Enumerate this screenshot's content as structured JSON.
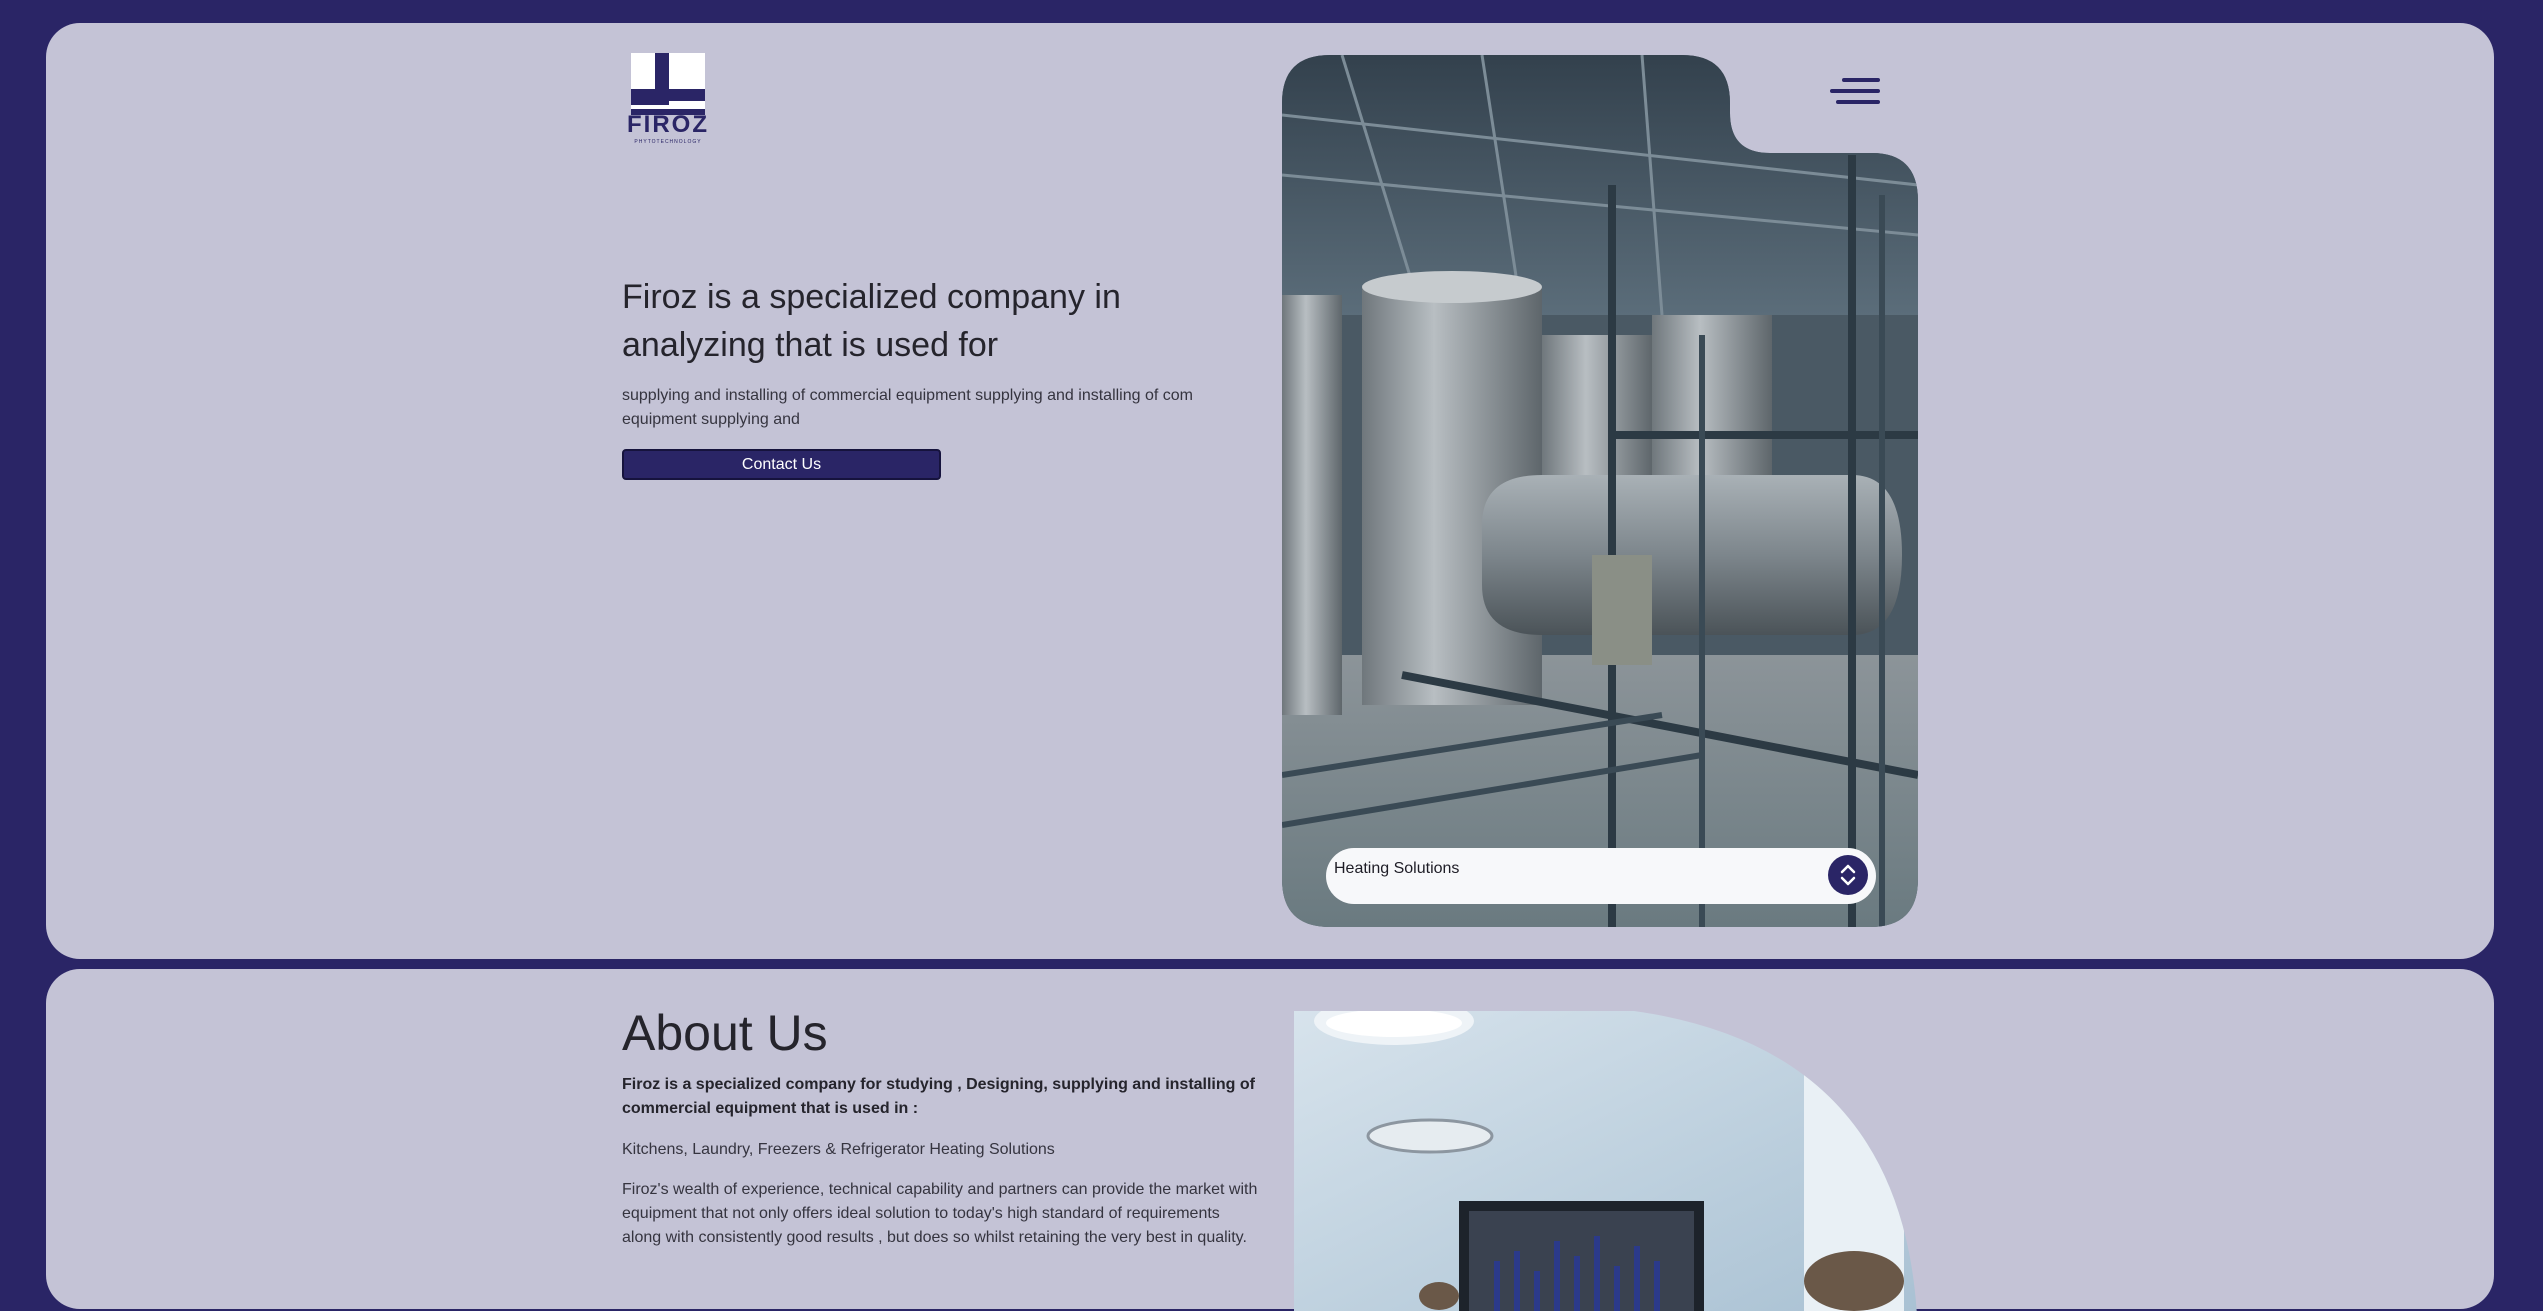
{
  "brand": {
    "name": "FIROZ",
    "tagline": "PHYTOTECHNOLOGY"
  },
  "hero": {
    "title": "Firoz is a specialized company in analyzing that is used for",
    "description": "supplying and installing of commercial equipment supplying and installing of com equipment supplying and",
    "cta_label": "Contact Us",
    "image_alt": "industrial steel tanks in a warehouse",
    "selector": {
      "selected": "Heating Solutions",
      "toggle_icon": "chevron-up-down-icon"
    },
    "menu_icon": "hamburger-menu-icon"
  },
  "about": {
    "title": "About Us",
    "lead": "Firoz is a specialized company for studying , Designing, supplying and installing of commercial equipment that is used in :",
    "list": "Kitchens, Laundry, Freezers & Refrigerator Heating Solutions",
    "body": "Firoz's wealth of experience, technical capability and partners can provide the market with equipment that not only offers ideal solution to today's high standard of requirements along with consistently good results , but does so whilst retaining the very best in quality.",
    "image_alt": "business meeting with chart on screen"
  },
  "colors": {
    "background": "#2a2566",
    "panel": "#c4c3d6",
    "accent": "#2a2566",
    "select_bg": "#f7f8fa"
  }
}
